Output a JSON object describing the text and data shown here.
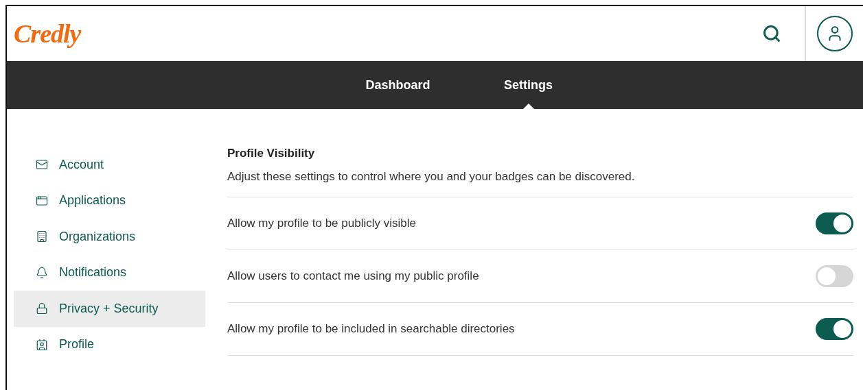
{
  "header": {
    "logo": "Credly"
  },
  "nav": {
    "tabs": [
      {
        "label": "Dashboard",
        "selected": false
      },
      {
        "label": "Settings",
        "selected": true
      }
    ]
  },
  "sidebar": {
    "items": [
      {
        "label": "Account",
        "kind": "mail",
        "selected": false
      },
      {
        "label": "Applications",
        "kind": "app",
        "selected": false
      },
      {
        "label": "Organizations",
        "kind": "building",
        "selected": false
      },
      {
        "label": "Notifications",
        "kind": "bell",
        "selected": false
      },
      {
        "label": "Privacy + Security",
        "kind": "lock",
        "selected": true
      },
      {
        "label": "Profile",
        "kind": "profile",
        "selected": false
      }
    ]
  },
  "section": {
    "title": "Profile Visibility",
    "description": "Adjust these settings to control where you and your badges can be discovered.",
    "settings": [
      {
        "label": "Allow my profile to be publicly visible",
        "on": true
      },
      {
        "label": "Allow users to contact me using my public profile",
        "on": false
      },
      {
        "label": "Allow my profile to be included in searchable directories",
        "on": true
      }
    ]
  }
}
